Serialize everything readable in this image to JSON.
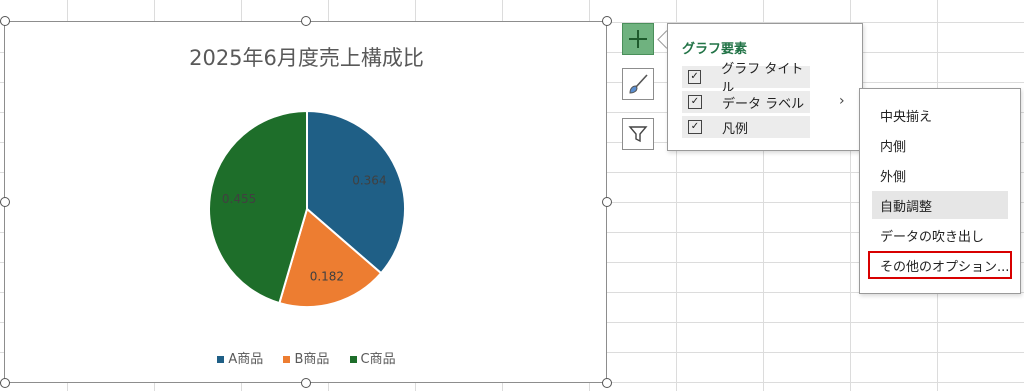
{
  "chart": {
    "title": "2025年6月度売上構成比",
    "legend": [
      "A商品",
      "B商品",
      "C商品"
    ]
  },
  "chart_data": {
    "type": "pie",
    "title": "2025年6月度売上構成比",
    "categories": [
      "A商品",
      "B商品",
      "C商品"
    ],
    "values": [
      0.364,
      0.182,
      0.455
    ],
    "data_labels": [
      "0.364",
      "0.182",
      "0.455"
    ],
    "colors": [
      "#1f5f86",
      "#ed7d31",
      "#1e6e2a"
    ],
    "legend_position": "bottom"
  },
  "side_buttons": [
    {
      "name": "chart-elements-button",
      "icon": "plus-icon"
    },
    {
      "name": "chart-styles-button",
      "icon": "brush-icon"
    },
    {
      "name": "chart-filters-button",
      "icon": "filter-icon"
    }
  ],
  "panel": {
    "title": "グラフ要素",
    "items": [
      {
        "label": "グラフ タイトル",
        "checked": true
      },
      {
        "label": "データ ラベル",
        "checked": true
      },
      {
        "label": "凡例",
        "checked": true
      }
    ]
  },
  "submenu": {
    "items": [
      "中央揃え",
      "内側",
      "外側",
      "自動調整",
      "データの吹き出し",
      "その他のオプション..."
    ]
  },
  "colors": {
    "accent_green": "#217346",
    "highlight_red": "#d80000"
  }
}
